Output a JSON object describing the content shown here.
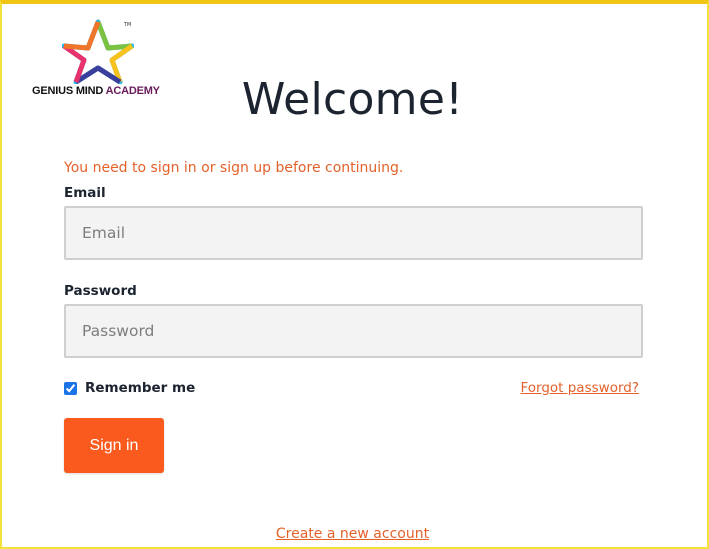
{
  "brand": {
    "logo_word1": "GENIUS MIND",
    "logo_word2": "ACADEMY",
    "trademark": "TM"
  },
  "page": {
    "title": "Welcome!",
    "notice": "You need to sign in or sign up before continuing."
  },
  "form": {
    "email_label": "Email",
    "email_placeholder": "Email",
    "email_value": "",
    "password_label": "Password",
    "password_placeholder": "Password",
    "password_value": "",
    "remember_label": "Remember me",
    "remember_checked": true,
    "forgot_link": "Forgot password?",
    "signin_button": "Sign in",
    "create_account_link": "Create a new account"
  },
  "colors": {
    "accent": "#fb5a1e",
    "link": "#e4612a",
    "frame_border": "#f2e23a",
    "logo_academy": "#6a1b5a"
  }
}
